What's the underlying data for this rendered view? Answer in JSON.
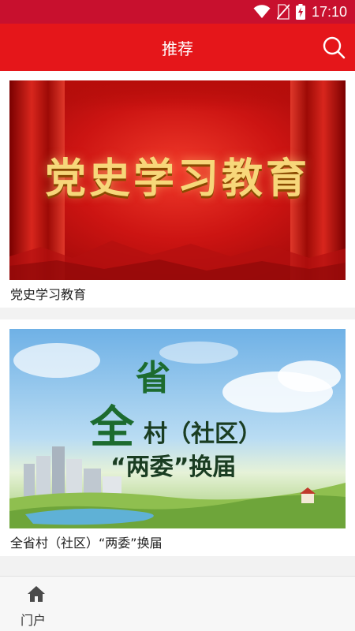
{
  "status_bar": {
    "time": "17:10",
    "icons": [
      "wifi-icon",
      "no-sim-icon",
      "battery-charging-icon"
    ]
  },
  "app_bar": {
    "title": "推荐",
    "search_icon": "search-icon"
  },
  "feed": {
    "items": [
      {
        "image_text": "党史学习教育",
        "title": "党史学习教育"
      },
      {
        "image_text": {
          "big": "全",
          "top": "省",
          "line1": "村（社区）",
          "line2": "“两委”换届"
        },
        "title": "全省村（社区）“两委”换届"
      }
    ]
  },
  "bottom_nav": {
    "items": [
      {
        "label": "门户",
        "icon": "home-icon"
      }
    ]
  },
  "colors": {
    "status_bar": "#c8102e",
    "app_bar": "#e5161a",
    "background": "#f2f2f2"
  }
}
